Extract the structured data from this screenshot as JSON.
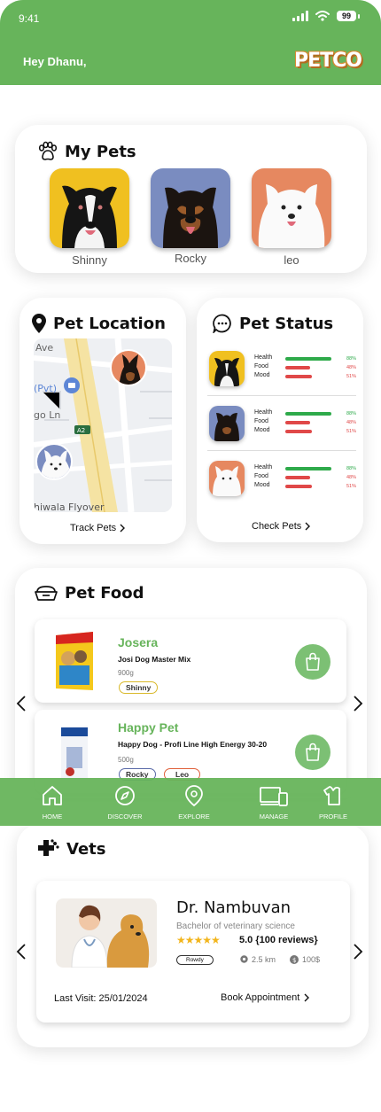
{
  "status_bar": {
    "time": "9:41",
    "battery": "99"
  },
  "header": {
    "greeting": "Hey Dhanu,",
    "logo": "PETCO"
  },
  "my_pets": {
    "title": "My Pets",
    "pets": [
      {
        "name": "Shinny",
        "bg": "#f0c020"
      },
      {
        "name": "Rocky",
        "bg": "#7a8cc0"
      },
      {
        "name": "leo",
        "bg": "#e68860"
      }
    ]
  },
  "pet_location": {
    "title": "Pet Location",
    "map_labels": {
      "ave": "Ave",
      "pvt": "(Pvt)",
      "go_ln": "go Ln",
      "a2": "A2",
      "flyover": "hiwala Flyover"
    },
    "link": "Track Pets"
  },
  "pet_status": {
    "title": "Pet Status",
    "labels": {
      "health": "Health",
      "food": "Food",
      "mood": "Mood"
    },
    "colors": {
      "health": "#2eaa4a",
      "low": "#e04848"
    },
    "pets": [
      {
        "name": "Shinny",
        "health": 88,
        "food": 48,
        "mood": 51,
        "health_text": "88%",
        "food_text": "48%",
        "mood_text": "51%"
      },
      {
        "name": "Rocky",
        "health": 88,
        "food": 48,
        "mood": 51,
        "health_text": "88%",
        "food_text": "48%",
        "mood_text": "51%"
      },
      {
        "name": "leo",
        "health": 88,
        "food": 48,
        "mood": 51,
        "health_text": "88%",
        "food_text": "48%",
        "mood_text": "51%"
      }
    ],
    "link": "Check Pets"
  },
  "pet_food": {
    "title": "Pet Food",
    "items": [
      {
        "brand": "Josera",
        "product": "Josi Dog Master Mix",
        "weight": "900g",
        "tags": [
          {
            "label": "Shinny",
            "color": "#d9b92a"
          }
        ]
      },
      {
        "brand": "Happy Pet",
        "product": "Happy Dog - Profi Line High Energy 30-20",
        "weight": "500g",
        "tags": [
          {
            "label": "Rocky",
            "color": "#5a6aa8"
          },
          {
            "label": "Leo",
            "color": "#e0603a"
          }
        ]
      }
    ]
  },
  "nav": {
    "items": [
      "HOME",
      "DISCOVER",
      "EXPLORE",
      "MANAGE",
      "PROFILE"
    ]
  },
  "vets": {
    "title": "Vets",
    "vet": {
      "name": "Dr. Nambuvan",
      "degree": "Bachelor of veterinary science",
      "stars": "★★★★★",
      "rating": "5.0 {100 reviews}",
      "tag": "Rowdy",
      "distance": "2.5 km",
      "fee": "100$",
      "last_visit": "Last Visit: 25/01/2024",
      "book": "Book Appointment"
    }
  },
  "colors": {
    "accent": "#67b45b",
    "text": "#111111"
  }
}
